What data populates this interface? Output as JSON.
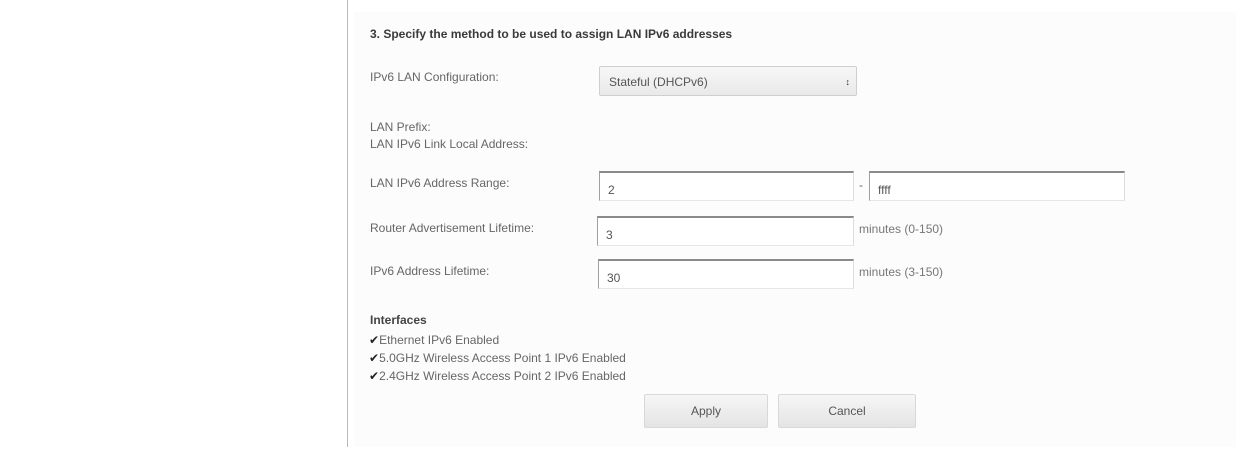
{
  "section": {
    "title": "3. Specify the method to be used to assign LAN IPv6 addresses"
  },
  "lan_config": {
    "label": "IPv6 LAN Configuration:",
    "selected": "Stateful (DHCPv6)",
    "arrow_icon": "updown-arrows-icon"
  },
  "lan_prefix": {
    "label": "LAN Prefix:"
  },
  "link_local": {
    "label": "LAN IPv6 Link Local Address:"
  },
  "address_range": {
    "label": "LAN IPv6 Address Range:",
    "start_value": "2",
    "separator": "-",
    "end_value": "ffff"
  },
  "router_adv": {
    "label": "Router Advertisement Lifetime:",
    "value": "3",
    "hint": "minutes (0-150)"
  },
  "addr_lifetime": {
    "label": "IPv6 Address Lifetime:",
    "value": "30",
    "hint": "minutes (3-150)"
  },
  "interfaces": {
    "title": "Interfaces",
    "items": [
      {
        "label": "Ethernet IPv6 Enabled",
        "checked": true
      },
      {
        "label": "5.0GHz Wireless Access Point 1 IPv6 Enabled",
        "checked": true
      },
      {
        "label": "2.4GHz Wireless Access Point 2 IPv6 Enabled",
        "checked": true
      }
    ]
  },
  "buttons": {
    "apply": "Apply",
    "cancel": "Cancel"
  }
}
